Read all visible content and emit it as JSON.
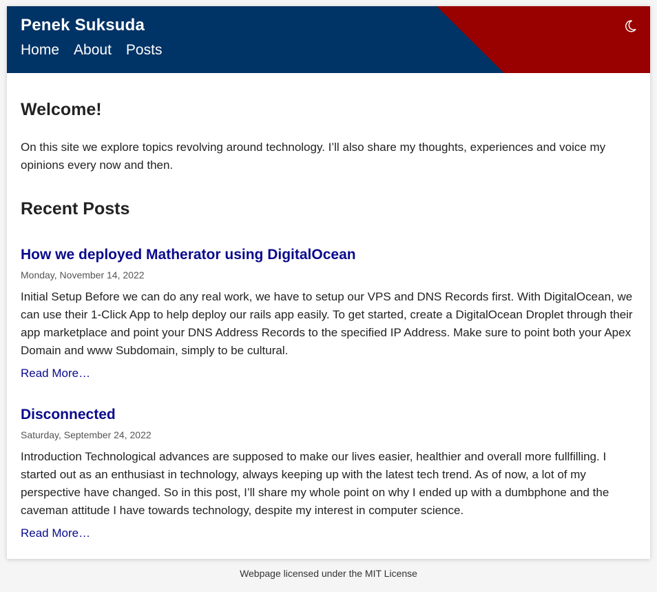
{
  "site": {
    "title": "Penek Suksuda"
  },
  "nav": {
    "items": [
      {
        "label": "Home"
      },
      {
        "label": "About"
      },
      {
        "label": "Posts"
      }
    ]
  },
  "theme_toggle": {
    "icon": "moon-icon"
  },
  "welcome": {
    "title": "Welcome!",
    "text": "On this site we explore topics revolving around technology. I’ll also share my thoughts, experiences and voice my opinions every now and then."
  },
  "recent": {
    "title": "Recent Posts",
    "posts": [
      {
        "title": "How we deployed Matherator using DigitalOcean",
        "date": "Monday, November 14, 2022",
        "excerpt": "Initial Setup Before we can do any real work, we have to setup our VPS and DNS Records first. With DigitalOcean, we can use their 1-Click App to help deploy our rails app easily. To get started, create a DigitalOcean Droplet through their app marketplace and point your DNS Address Records to the specified IP Address. Make sure to point both your Apex Domain and www Subdomain, simply to be cultural.",
        "read_more": "Read More…"
      },
      {
        "title": "Disconnected",
        "date": "Saturday, September 24, 2022",
        "excerpt": "Introduction Technological advances are supposed to make our lives easier, healthier and overall more fullfilling. I started out as an enthusiast in technology, always keeping up with the latest tech trend. As of now, a lot of my perspective have changed. So in this post, I’ll share my whole point on why I ended up with a dumbphone and the caveman attitude I have towards technology, despite my interest in computer science.",
        "read_more": "Read More…"
      }
    ]
  },
  "footer": {
    "text": "Webpage licensed under the MIT License"
  },
  "colors": {
    "header_blue": "#003366",
    "header_red": "#990000",
    "link_blue": "#0a0a8c"
  }
}
